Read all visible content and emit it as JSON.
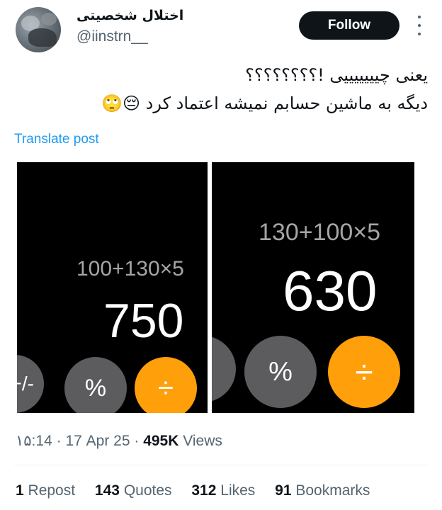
{
  "user": {
    "display_name": "اختلال شخصیتی",
    "handle": "@iinstrn__"
  },
  "follow_label": "Follow",
  "post": {
    "line1": "یعنی چیییییییی !؟؟؟؟؟؟؟؟",
    "line2": "دیگه به ماشین حسابم نمیشه اعتماد کرد 😔🙄",
    "translate_label": "Translate post"
  },
  "media": {
    "left": {
      "expression": "100+130×5",
      "result": "750",
      "keys": [
        "+/-",
        "%",
        "÷"
      ]
    },
    "right": {
      "expression": "130+100×5",
      "result": "630",
      "keys": [
        "%",
        "÷"
      ]
    },
    "colors": {
      "gray_key": "#5c5c5e",
      "orange_key": "#ff9f0a"
    }
  },
  "meta": {
    "time": "۱۵:14",
    "date": "17 Apr 25",
    "views_count": "495K",
    "views_label": "Views"
  },
  "stats": {
    "reposts_count": "1",
    "reposts_label": "Repost",
    "quotes_count": "143",
    "quotes_label": "Quotes",
    "likes_count": "312",
    "likes_label": "Likes",
    "bookmarks_count": "91",
    "bookmarks_label": "Bookmarks"
  }
}
